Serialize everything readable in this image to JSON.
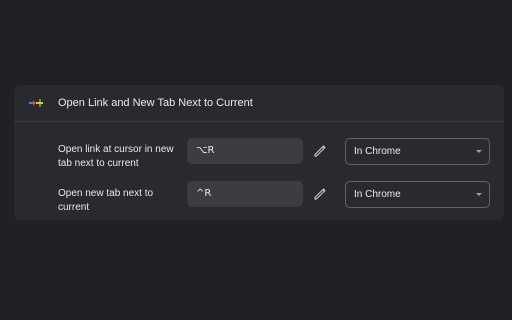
{
  "extension": {
    "title": "Open Link and New Tab Next to Current",
    "icon": "ext-arrow-plus-icon",
    "colors": {
      "background": "#202124",
      "card": "#292a2d",
      "field": "#3c3d40",
      "icon_arrow": "#ea4335",
      "icon_plus": "#fbbc04"
    }
  },
  "shortcuts": [
    {
      "label": "Open link at cursor in new tab next to current",
      "shortcut": "⌥R",
      "edit_icon": "pencil-icon",
      "scope": "In Chrome"
    },
    {
      "label": "Open new tab next to current",
      "shortcut": "^R",
      "edit_icon": "pencil-icon",
      "scope": "In Chrome"
    }
  ]
}
